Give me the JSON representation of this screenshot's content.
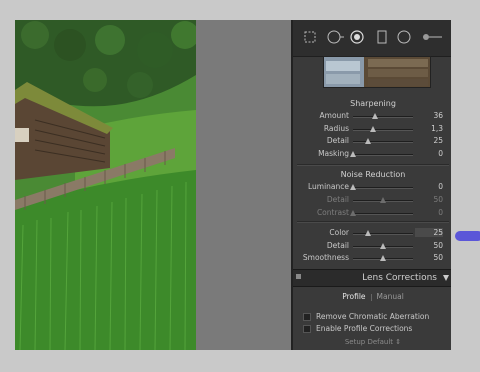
{
  "toolbar": {
    "icons": [
      "crop-icon",
      "spot-removal-icon",
      "red-eye-icon",
      "graduated-filter-icon",
      "radial-filter-icon",
      "adjustment-brush-icon"
    ]
  },
  "sharpening": {
    "title": "Sharpening",
    "rows": [
      {
        "label": "Amount",
        "value": "36",
        "level": 0.36,
        "dim": false
      },
      {
        "label": "Radius",
        "value": "1,3",
        "level": 0.33,
        "dim": false
      },
      {
        "label": "Detail",
        "value": "25",
        "level": 0.25,
        "dim": false
      },
      {
        "label": "Masking",
        "value": "0",
        "level": 0.0,
        "dim": false
      }
    ]
  },
  "noise_reduction": {
    "title": "Noise Reduction",
    "rows": [
      {
        "label": "Luminance",
        "value": "0",
        "level": 0.0,
        "dim": false
      },
      {
        "label": "Detail",
        "value": "50",
        "level": 0.5,
        "dim": true
      },
      {
        "label": "Contrast",
        "value": "0",
        "level": 0.0,
        "dim": true
      },
      {
        "label": "Color",
        "value": "25",
        "level": 0.25,
        "dim": false,
        "boxed": true
      },
      {
        "label": "Detail",
        "value": "50",
        "level": 0.5,
        "dim": false
      },
      {
        "label": "Smoothness",
        "value": "50",
        "level": 0.5,
        "dim": false
      }
    ]
  },
  "lens_corrections": {
    "title": "Lens Corrections",
    "tabs": [
      "Profile",
      "Manual"
    ],
    "active_tab": "Profile",
    "checkboxes": [
      {
        "label": "Remove Chromatic Aberration",
        "checked": false
      },
      {
        "label": "Enable Profile Corrections",
        "checked": false
      }
    ],
    "setup_label": "Setup",
    "setup_value": "Default"
  },
  "colors": {
    "panel_bg": "#3a3a3a",
    "cursor": "#5b56d8",
    "slider_accent": "#c04040"
  }
}
